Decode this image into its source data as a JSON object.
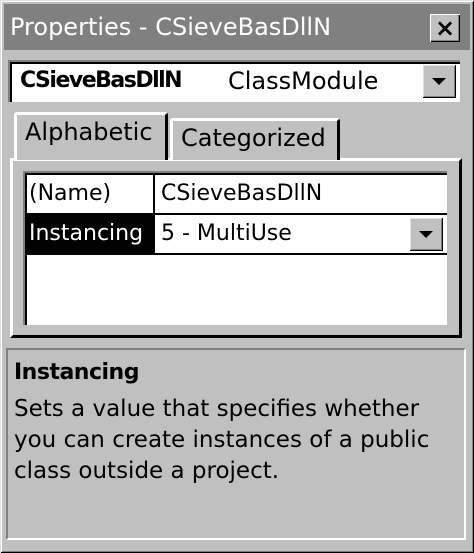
{
  "window": {
    "title": "Properties - CSieveBasDllN",
    "close_glyph": "×"
  },
  "object_combo": {
    "object_name": "CSieveBasDllN",
    "object_type": "ClassModule"
  },
  "tabs": [
    {
      "label": "Alphabetic",
      "active": true
    },
    {
      "label": "Categorized",
      "active": false
    }
  ],
  "properties": [
    {
      "name": "(Name)",
      "value": "CSieveBasDllN",
      "selected": false
    },
    {
      "name": "Instancing",
      "value": "5 - MultiUse",
      "selected": true
    }
  ],
  "description": {
    "title": "Instancing",
    "body": "Sets a value that specifies whether you can create instances of a public class outside a project."
  },
  "colors": {
    "face": "#c0c0c0",
    "titlebar_inactive": "#808080",
    "selection": "#000000"
  }
}
